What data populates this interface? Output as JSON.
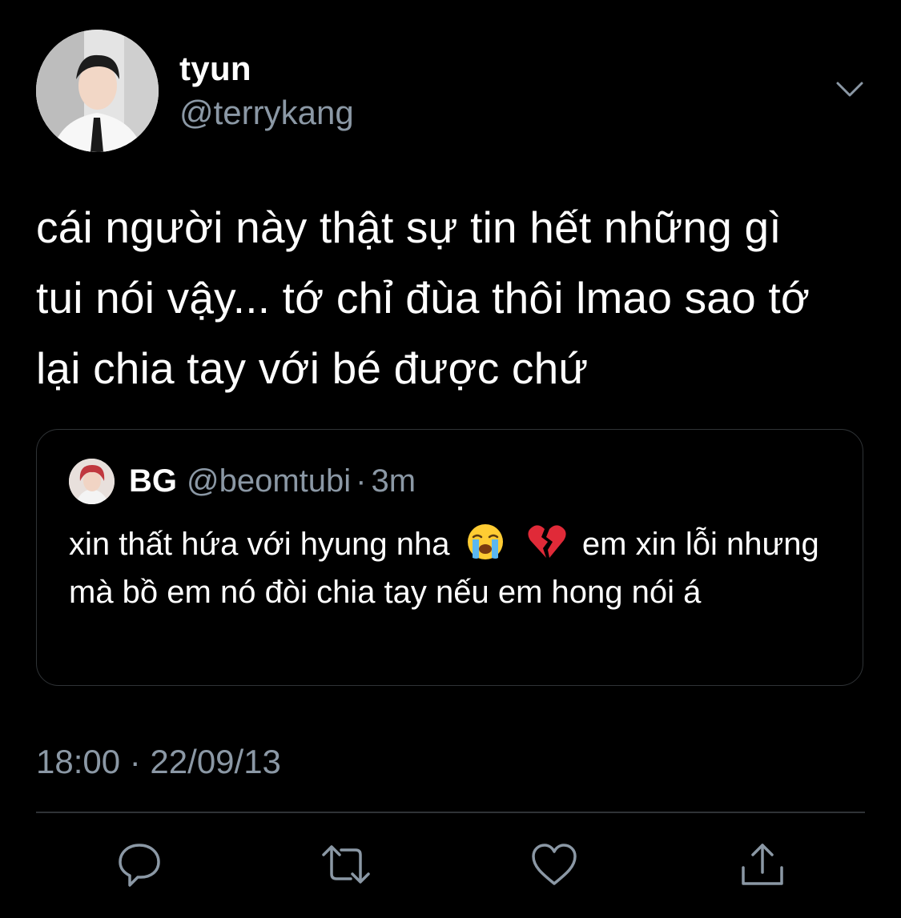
{
  "tweet": {
    "author_name": "tyun",
    "author_handle": "@terrykang",
    "text": "cái người này thật sự tin hết những gì\ntui nói vậy... tớ chỉ đùa thôi lmao sao tớ\nlại chia tay với bé được chứ",
    "timestamp": "18:00 · 22/09/13"
  },
  "quote": {
    "author_name": "BG",
    "author_handle": "@beomtubi",
    "separator": "·",
    "time": "3m",
    "text_part1": "xin thất hứa với hyung nha",
    "emoji_1": "loudly-crying-face",
    "emoji_2": "broken-heart",
    "text_part2": "em xin lỗi nhưng mà bồ em nó đòi chia tay nếu em hong nói á"
  },
  "actions": {
    "reply_icon": "speech-bubble-icon",
    "retweet_icon": "retweet-icon",
    "like_icon": "heart-icon",
    "share_icon": "share-icon"
  },
  "colors": {
    "background": "#000000",
    "primary_text": "#ffffff",
    "secondary_text": "#8b98a5",
    "border": "#2f3336",
    "icon": "#8b98a5"
  }
}
